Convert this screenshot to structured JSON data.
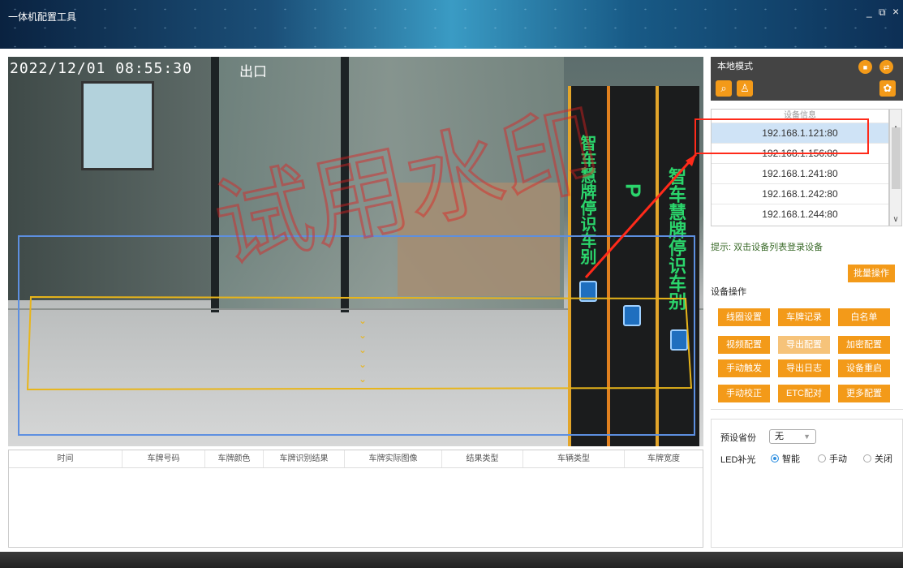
{
  "window": {
    "title": "一体机配置工具",
    "minimize_glyph": "_",
    "restore_glyph": "⧉",
    "close_glyph": "×"
  },
  "video": {
    "timestamp": "2022/12/01   08:55:30",
    "direction_label": "出口",
    "watermark_text": "试用水印",
    "gate_text_1": "智车慧牌停识车别",
    "gate_text_2": "P",
    "gate_text_3": "智车慧牌停识车别"
  },
  "right_panel": {
    "mode_label": "本地模式",
    "icons": [
      "video-icon",
      "switch-icon",
      "search-icon",
      "user-search-icon",
      "settings-icon"
    ],
    "device_list_header": "设备信息",
    "devices": [
      "192.168.1.121:80",
      "192.168.1.156:80",
      "192.168.1.241:80",
      "192.168.1.242:80",
      "192.168.1.244:80"
    ],
    "selected_device": "192.168.1.121:80",
    "hint": "提示: 双击设备列表登录设备",
    "batch_button": "批量操作",
    "ops_title": "设备操作",
    "ops_buttons": [
      [
        "线圈设置",
        "车牌记录",
        "白名单"
      ],
      [
        "视频配置",
        "导出配置",
        "加密配置"
      ],
      [
        "手动触发",
        "导出日志",
        "设备重启"
      ],
      [
        "手动校正",
        "ETC配对",
        "更多配置"
      ]
    ],
    "preset_label": "预设省份",
    "preset_value": "无",
    "led_label": "LED补光",
    "led_options": [
      "智能",
      "手动",
      "关闭"
    ],
    "led_selected": "智能"
  },
  "records_table": {
    "columns": [
      "时间",
      "车牌号码",
      "车牌颜色",
      "车牌识别结果",
      "车牌实际图像",
      "结果类型",
      "车辆类型",
      "车牌宽度"
    ]
  },
  "colors": {
    "accent": "#f39a19",
    "selected_row": "#cfe3f6",
    "roi_blue": "#5d8fe0",
    "roi_yellow": "#e8b51a",
    "watermark": "#e02020"
  }
}
